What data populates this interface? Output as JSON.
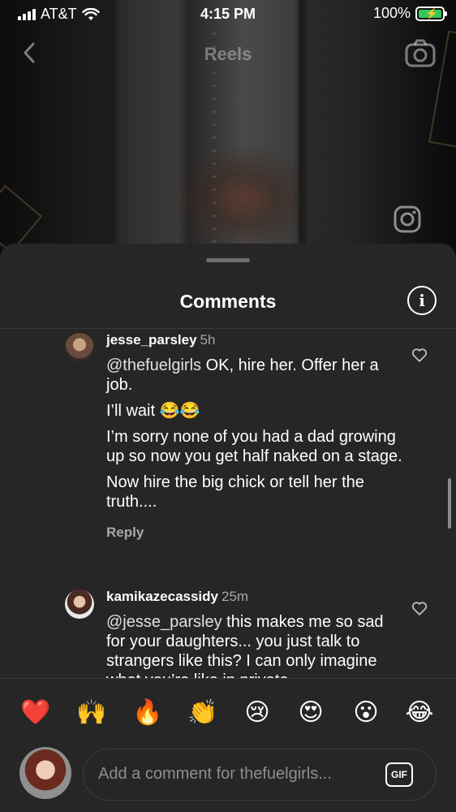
{
  "status_bar": {
    "carrier": "AT&T",
    "time": "4:15 PM",
    "battery": "100%"
  },
  "reels_nav": {
    "title": "Reels",
    "back_icon": "chevron-left-icon",
    "camera_icon": "camera-icon"
  },
  "sheet": {
    "title": "Comments",
    "info_icon": "info-icon"
  },
  "comments": [
    {
      "username": "jesse_parsley",
      "time": "5h",
      "mention": "@thefuelgirls",
      "paragraph_1_rest": " OK, hire her. Offer her a job.",
      "paragraph_2": "I’ll wait 😂😂",
      "paragraph_3": "I’m sorry none of you had a dad growing up so now you get half naked on a stage.",
      "paragraph_4": "Now hire the big chick or tell her the truth....",
      "reply_label": "Reply"
    },
    {
      "username": "kamikazecassidy",
      "time": "25m",
      "mention": "@jesse_parsley",
      "paragraph_1_rest": " this makes me so sad for your daughters... you just talk to strangers like this? I can only imagine what you’re like in private"
    }
  ],
  "emoji_bar": [
    "❤️",
    "🙌",
    "🔥",
    "👏",
    "😢",
    "😍",
    "😮",
    "😂"
  ],
  "input": {
    "placeholder": "Add a comment for thefuelgirls...",
    "gif_label": "GIF"
  },
  "colors": {
    "sheet_bg": "#262626",
    "secondary_text": "#a8a8a8",
    "battery_green": "#34c759"
  }
}
